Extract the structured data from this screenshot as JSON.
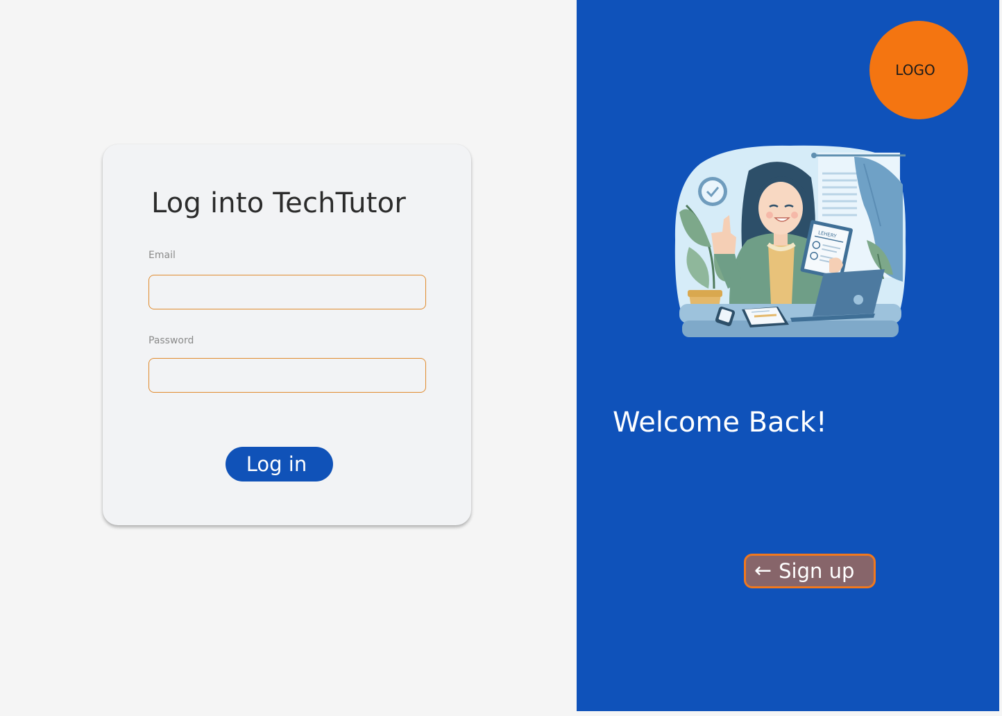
{
  "login_card": {
    "title": "Log into TechTutor",
    "email_label": "Email",
    "email_value": "",
    "password_label": "Password",
    "password_value": "",
    "login_button": "Log in"
  },
  "side_panel": {
    "logo_text": "LOGO",
    "illustration_icon": "woman-at-desk-illustration",
    "welcome_text": "Welcome Back!",
    "signup_button": "Sign up",
    "signup_icon": "arrow-left-icon"
  },
  "colors": {
    "page_background": "#f5f5f5",
    "card_background": "#f2f3f5",
    "primary_blue": "#0f52ba",
    "accent_orange": "#f47511",
    "signup_fill": "#87656a"
  }
}
